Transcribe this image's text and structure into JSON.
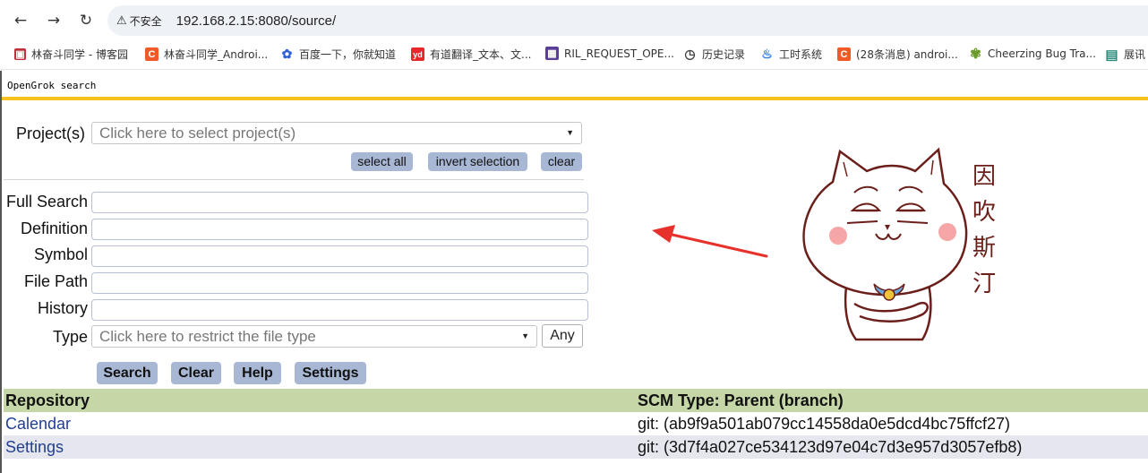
{
  "browser": {
    "security_label": "不安全",
    "url": "192.168.2.15:8080/source/",
    "bookmarks": [
      {
        "icon": "cnblogs-icon",
        "color": "#c0303a",
        "glyph": "▣",
        "label": "林奋斗同学 - 博客园"
      },
      {
        "icon": "csdn-icon",
        "color": "#f05a28",
        "glyph": "C",
        "label": "林奋斗同学_Androi..."
      },
      {
        "icon": "baidu-icon",
        "color": "#2f5fd8",
        "glyph": "✿",
        "label": "百度一下，你就知道"
      },
      {
        "icon": "youdao-icon",
        "color": "#e7262d",
        "glyph": "yd",
        "label": "有道翻译_文本、文..."
      },
      {
        "icon": "bookmark-page-icon",
        "color": "#5a3e9a",
        "glyph": "▦",
        "label": "RIL_REQUEST_OPE..."
      },
      {
        "icon": "history-icon",
        "color": "#ffffff",
        "glyph": "◷",
        "label": "历史记录"
      },
      {
        "icon": "flame-icon",
        "color": "#ffffff",
        "glyph": "♨",
        "label": "工时系统"
      },
      {
        "icon": "csdn-icon",
        "color": "#f05a28",
        "glyph": "C",
        "label": "(28条消息) androi..."
      },
      {
        "icon": "bug-tracker-icon",
        "color": "#ffffff",
        "glyph": "✾",
        "label": "Cheerzing Bug Tra..."
      },
      {
        "icon": "page-icon",
        "color": "#ffffff",
        "glyph": "▤",
        "label": "展讯"
      }
    ]
  },
  "header": {
    "title": "OpenGrok search"
  },
  "project": {
    "label": "Project(s)",
    "placeholder": "Click here to select project(s)",
    "select_all": "select all",
    "invert_selection": "invert selection",
    "clear": "clear"
  },
  "search_fields": {
    "full_search": "Full Search",
    "definition": "Definition",
    "symbol": "Symbol",
    "file_path": "File Path",
    "history": "History",
    "type": "Type",
    "type_placeholder": "Click here to restrict the file type",
    "type_any": "Any"
  },
  "buttons": {
    "search": "Search",
    "clear": "Clear",
    "help": "Help",
    "settings": "Settings"
  },
  "sticker": {
    "text": [
      "因",
      "吹",
      "斯",
      "汀"
    ]
  },
  "repositories": {
    "headers": [
      "Repository",
      "SCM Type: Parent (branch)"
    ],
    "rows": [
      {
        "name": "Calendar",
        "scm": "git: (ab9f9a501ab079cc14558da0e5dcd4bc75ffcf27)"
      },
      {
        "name": "Settings",
        "scm": "git: (3d7f4a027ce534123d97e04c7d3e957d3057efb8)"
      }
    ]
  },
  "colors": {
    "accent_bar": "#f7c21a",
    "button": "#a7b7d4",
    "table_head": "#c5d6a7",
    "link": "#213e8f",
    "annotation_arrow": "#e8312a"
  }
}
